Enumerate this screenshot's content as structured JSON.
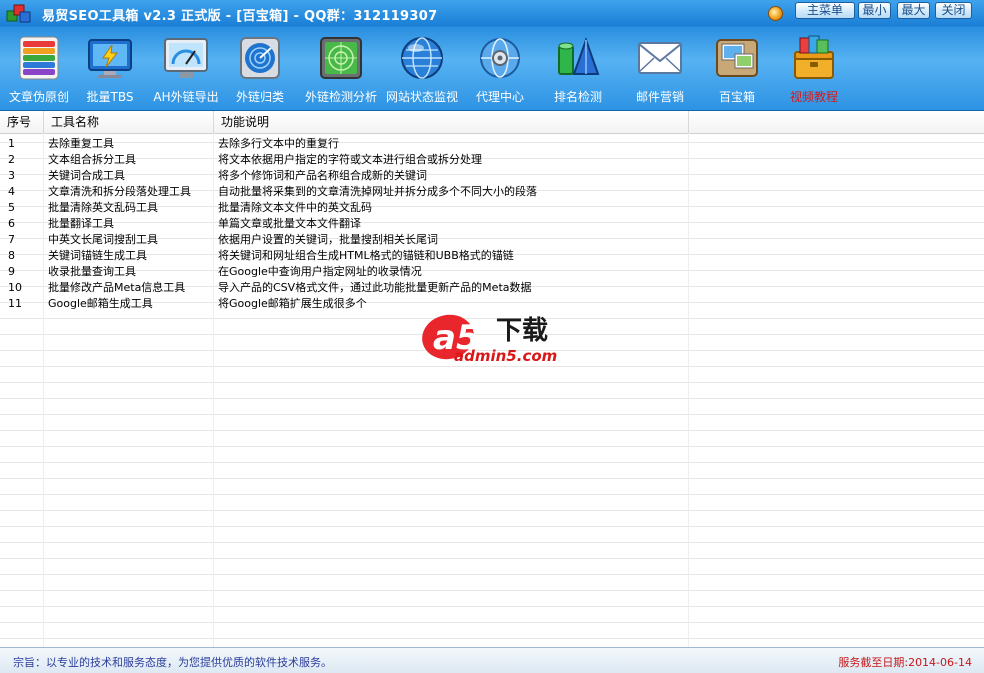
{
  "window": {
    "title": "易贸SEO工具箱 v2.3 正式版 - [百宝箱] - QQ群：312119307",
    "buttons": {
      "main_menu": "主菜单",
      "minimize": "最小",
      "maximize": "最大",
      "close": "关闭"
    }
  },
  "toolbar": {
    "items": [
      {
        "label": "文章伪原创",
        "icon": "books-icon"
      },
      {
        "label": "批量TBS",
        "icon": "monitor-bolt-icon"
      },
      {
        "label": "AH外链导出",
        "icon": "gauge-monitor-icon"
      },
      {
        "label": "外链归类",
        "icon": "radar-target-icon"
      },
      {
        "label": "外链检测分析",
        "icon": "radar-screen-icon"
      },
      {
        "label": "网站状态监视",
        "icon": "globe-icon"
      },
      {
        "label": "代理中心",
        "icon": "globe-gear-icon"
      },
      {
        "label": "排名检测",
        "icon": "shapes-icon"
      },
      {
        "label": "邮件营销",
        "icon": "envelope-icon"
      },
      {
        "label": "百宝箱",
        "icon": "photo-box-icon"
      },
      {
        "label": "视频教程",
        "icon": "toolbox-icon"
      }
    ],
    "highlight_color": "#d81818"
  },
  "grid": {
    "columns": [
      "序号",
      "工具名称",
      "功能说明"
    ],
    "rows": [
      {
        "num": "1",
        "name": "去除重复工具",
        "desc": "去除多行文本中的重复行"
      },
      {
        "num": "2",
        "name": "文本组合拆分工具",
        "desc": "将文本依据用户指定的字符或文本进行组合或拆分处理"
      },
      {
        "num": "3",
        "name": "关键词合成工具",
        "desc": "将多个修饰词和产品名称组合成新的关键词"
      },
      {
        "num": "4",
        "name": "文章清洗和拆分段落处理工具",
        "desc": "自动批量将采集到的文章清洗掉网址并拆分成多个不同大小的段落"
      },
      {
        "num": "5",
        "name": "批量清除英文乱码工具",
        "desc": "批量清除文本文件中的英文乱码"
      },
      {
        "num": "6",
        "name": "批量翻译工具",
        "desc": "单篇文章或批量文本文件翻译"
      },
      {
        "num": "7",
        "name": "中英文长尾词搜刮工具",
        "desc": "依据用户设置的关键词，批量搜刮相关长尾词"
      },
      {
        "num": "8",
        "name": "关键词锚链生成工具",
        "desc": "将关键词和网址组合生成HTML格式的锚链和UBB格式的锚链"
      },
      {
        "num": "9",
        "name": "收录批量查询工具",
        "desc": "在Google中查询用户指定网址的收录情况"
      },
      {
        "num": "10",
        "name": "批量修改产品Meta信息工具",
        "desc": "导入产品的CSV格式文件，通过此功能批量更新产品的Meta数据"
      },
      {
        "num": "11",
        "name": "Google邮箱生成工具",
        "desc": "将Google邮箱扩展生成很多个"
      }
    ]
  },
  "watermark": {
    "brand": "a5",
    "tagline": "下载",
    "site": "admin5.com"
  },
  "status": {
    "left": "宗旨：以专业的技术和服务态度，为您提供优质的软件技术服务。",
    "right": "服务截至日期:2014-06-14"
  }
}
